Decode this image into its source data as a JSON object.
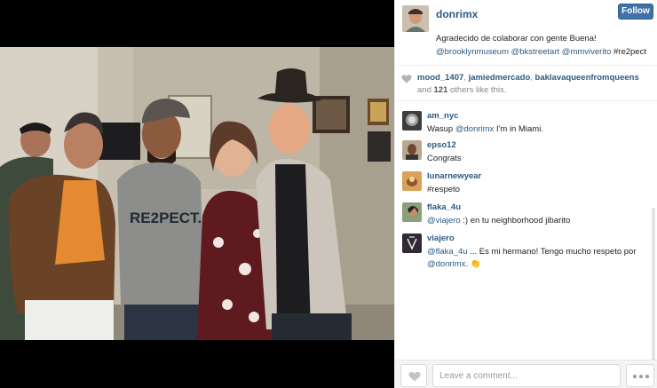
{
  "post": {
    "username": "donrimx",
    "follow_label": "Follow",
    "caption": {
      "text": "Agradecido de colaborar con gente Buena!",
      "mention_1": "@brooklynmuseum",
      "mention_2": "@bkstreetart",
      "mention_3": "@mmviverito",
      "hashtag": "#re2pect"
    }
  },
  "likes": {
    "name_1": "mood_1407",
    "name_2": "jamiedmercado",
    "name_3": "baklavaqueenfromqueens",
    "and_label": "and",
    "count": "121",
    "suffix": "others like this."
  },
  "comments": [
    {
      "user": "am_nyc",
      "text": "Wasup",
      "mention": "@donrimx",
      "text_after": "I'm in Miami."
    },
    {
      "user": "epso12",
      "text": "Congrats"
    },
    {
      "user": "lunarnewyear",
      "text": "#respeto"
    },
    {
      "user": "flaka_4u",
      "mention": "@viajero",
      "text_after": ":) en tu neighborhood jibarito"
    },
    {
      "user": "viajero",
      "mention": "@flaka_4u",
      "text_after": "... Es mi hermano! Tengo mucho respeto por",
      "mention_2": "@donrimx",
      "end": ".",
      "emoji": "👏"
    }
  ],
  "footer": {
    "comment_placeholder": "Leave a comment..."
  },
  "colors": {
    "link": "#2b5a83",
    "follow_button": "#3f72a7",
    "photo_background": "#000000"
  },
  "icons": {
    "likes": "heart-icon",
    "like_button": "heart-icon",
    "more": "more-dots-icon"
  }
}
